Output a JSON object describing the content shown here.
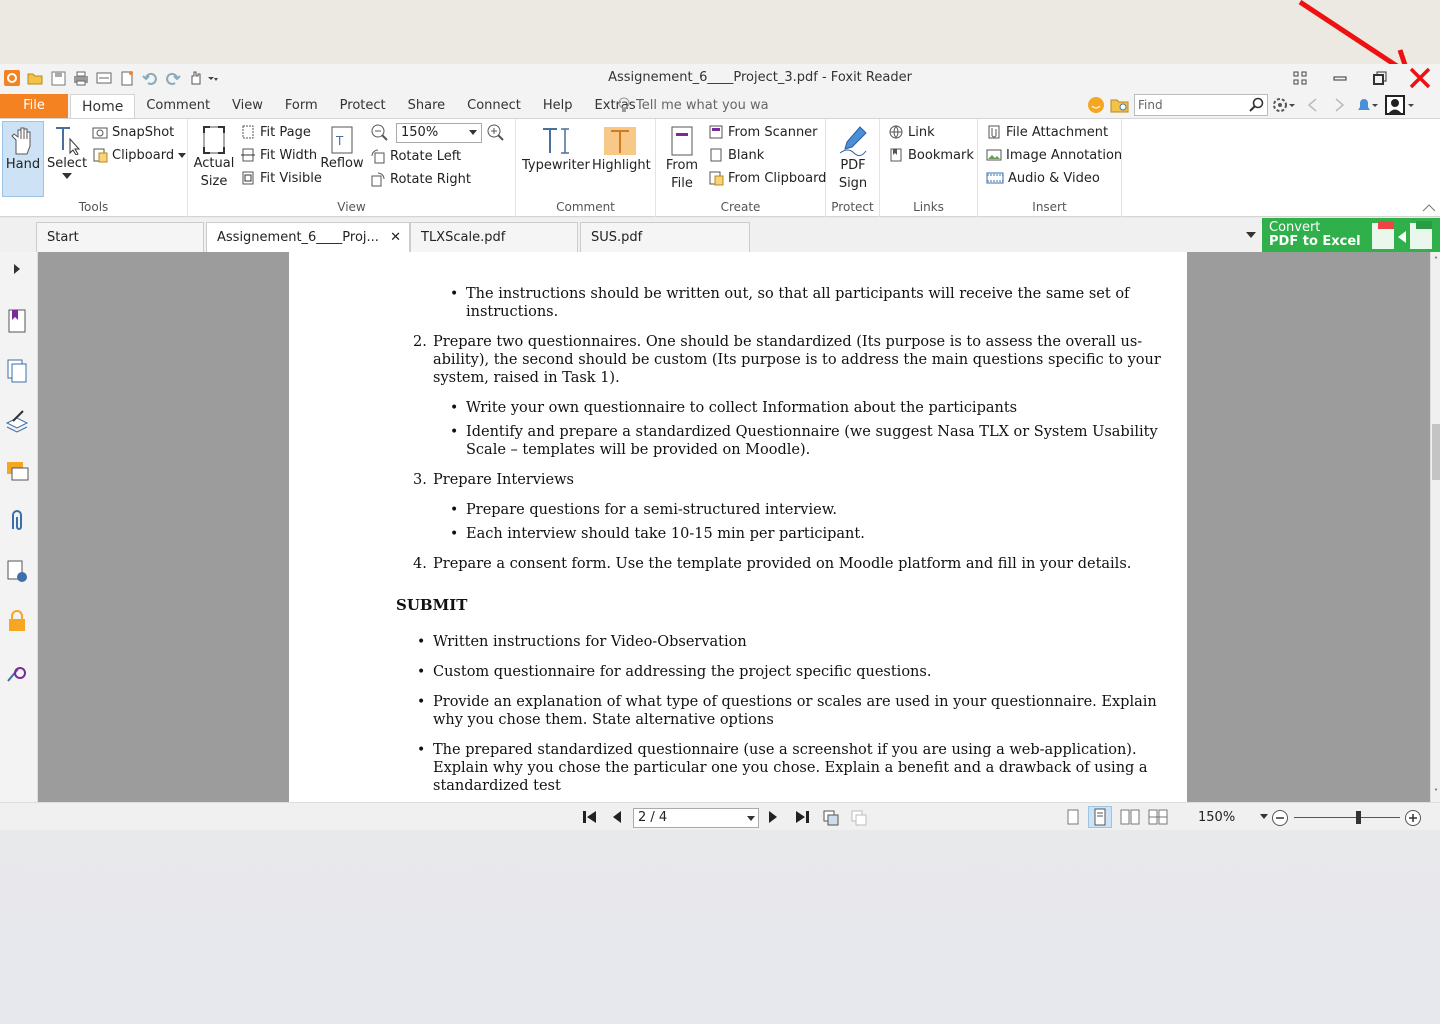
{
  "window": {
    "title": "Assignement_6____Project_3.pdf - Foxit Reader"
  },
  "menu": {
    "file": "File",
    "tabs": [
      "Home",
      "Comment",
      "View",
      "Form",
      "Protect",
      "Share",
      "Connect",
      "Help",
      "Extras"
    ],
    "active_tab": "Home",
    "tell_me": "Tell me what you wa",
    "find_placeholder": "Find"
  },
  "ribbon": {
    "tools": {
      "label": "Tools",
      "hand": "Hand",
      "select": "Select",
      "snapshot": "SnapShot",
      "clipboard": "Clipboard"
    },
    "view": {
      "label": "View",
      "actual_size_1": "Actual",
      "actual_size_2": "Size",
      "fit_page": "Fit Page",
      "fit_width": "Fit Width",
      "fit_visible": "Fit Visible",
      "reflow": "Reflow",
      "zoom": "150%",
      "rotate_left": "Rotate Left",
      "rotate_right": "Rotate Right"
    },
    "comment": {
      "label": "Comment",
      "typewriter": "Typewriter",
      "highlight": "Highlight"
    },
    "create": {
      "label": "Create",
      "from_file_1": "From",
      "from_file_2": "File",
      "from_scanner": "From Scanner",
      "blank": "Blank",
      "from_clipboard": "From Clipboard"
    },
    "protect": {
      "label": "Protect",
      "pdf_sign_1": "PDF",
      "pdf_sign_2": "Sign"
    },
    "links": {
      "label": "Links",
      "link": "Link",
      "bookmark": "Bookmark"
    },
    "insert": {
      "label": "Insert",
      "file_attachment": "File Attachment",
      "image_annotation": "Image Annotation",
      "audio_video": "Audio & Video"
    }
  },
  "doc_tabs": {
    "start": "Start",
    "tab1": "Assignement_6____Proj...",
    "tab2": "TLXScale.pdf",
    "tab3": "SUS.pdf",
    "convert_1": "Convert",
    "convert_2": "PDF to Excel"
  },
  "document": {
    "l1": "The instructions should be written out, so that all participants will receive the same set of",
    "l2": "instructions.",
    "n2": "2.",
    "l3": "Prepare two questionnaires. One should be standardized (Its purpose is to assess the overall us-",
    "l4": "ability), the second should be custom (Its purpose is to address the main questions specific to your",
    "l5": "system, raised in Task 1).",
    "l6": "Write your own questionnaire to collect Information about the participants",
    "l7": "Identify and prepare a standardized Questionnaire (we suggest Nasa TLX or System Usability",
    "l8": "Scale – templates will be provided on Moodle).",
    "n3": "3.",
    "l9": "Prepare Interviews",
    "l10": "Prepare questions for a semi-structured interview.",
    "l11": "Each interview should take 10-15 min per participant.",
    "n4": "4.",
    "l12": "Prepare a consent form. Use the template provided on Moodle platform and fill in your details.",
    "submit": "SUBMIT",
    "s1": "Written instructions for Video-Observation",
    "s2": "Custom questionnaire for addressing the project specific questions.",
    "s3a": "Provide an explanation of what type of questions or scales are used in your questionnaire. Explain",
    "s3b": "why you chose them. State alternative options",
    "s4a": "The prepared standardized questionnaire (use a screenshot if you are using a web-application).",
    "s4b": "Explain why you chose the particular one you chose. Explain a benefit and a drawback of using a",
    "s4c": "standardized test"
  },
  "status": {
    "page": "2 / 4",
    "zoom": "150%",
    "zoom_level_fraction": 0.6
  },
  "colors": {
    "accent_orange": "#f58220",
    "convert_green": "#2fb04a",
    "annotation_red": "#e11"
  }
}
